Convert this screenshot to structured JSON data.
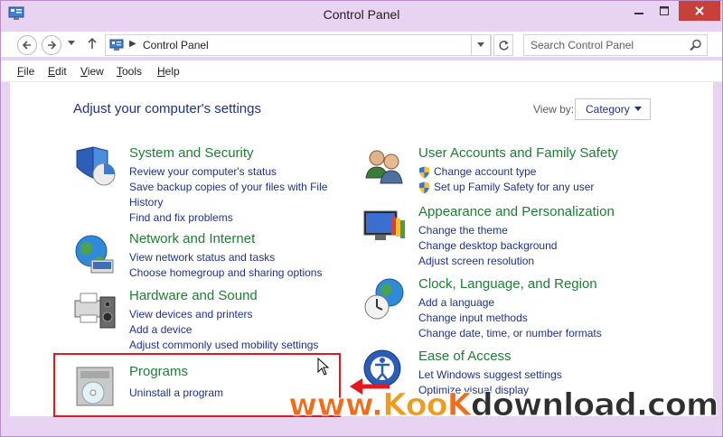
{
  "window": {
    "title": "Control Panel"
  },
  "address": {
    "path": "Control Panel",
    "search_placeholder": "Search Control Panel"
  },
  "menu": [
    {
      "key": "F",
      "rest": "ile"
    },
    {
      "key": "E",
      "rest": "dit"
    },
    {
      "key": "V",
      "rest": "iew"
    },
    {
      "key": "T",
      "rest": "ools"
    },
    {
      "key": "H",
      "rest": "elp"
    }
  ],
  "page": {
    "title": "Adjust your computer's settings",
    "view_by_label": "View by:",
    "view_by_value": "Category"
  },
  "categories": {
    "system": {
      "title": "System and Security",
      "links": [
        "Review your computer's status",
        "Save backup copies of your files with File History",
        "Find and fix problems"
      ]
    },
    "network": {
      "title": "Network and Internet",
      "links": [
        "View network status and tasks",
        "Choose homegroup and sharing options"
      ]
    },
    "hardware": {
      "title": "Hardware and Sound",
      "links": [
        "View devices and printers",
        "Add a device",
        "Adjust commonly used mobility settings"
      ]
    },
    "programs": {
      "title": "Programs",
      "links": [
        "Uninstall a program"
      ]
    },
    "users": {
      "title": "User Accounts and Family Safety",
      "links": [
        "Change account type",
        "Set up Family Safety for any user"
      ]
    },
    "appearance": {
      "title": "Appearance and Personalization",
      "links": [
        "Change the theme",
        "Change desktop background",
        "Adjust screen resolution"
      ]
    },
    "clock": {
      "title": "Clock, Language, and Region",
      "links": [
        "Add a language",
        "Change input methods",
        "Change date, time, or number formats"
      ]
    },
    "ease": {
      "title": "Ease of Access",
      "links": [
        "Let Windows suggest settings",
        "Optimize visual display"
      ]
    }
  },
  "watermark": {
    "part1": "www.",
    "part2": "Koo",
    "part3": "K",
    "part4": "download.com"
  },
  "colors": {
    "link": "#1e3287",
    "category_title": "#1c7e33",
    "close_button": "#c7403a",
    "highlight": "#e3181f",
    "frame": "#e9d3f3"
  }
}
